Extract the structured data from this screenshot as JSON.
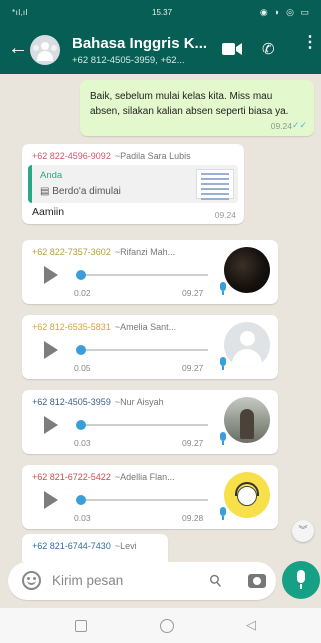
{
  "status_bar": {
    "signal": "*ıl‚ıl",
    "time": "15.37",
    "icons": "◉ ◗ ◎ ▭"
  },
  "header": {
    "title": "Bahasa Inggris K...",
    "subtitle": "+62 812-4505-3959, +62..."
  },
  "messages": {
    "outgoing": {
      "text": "Baik,  sebelum mulai kelas kita. Miss mau absen, silakan kalian absen seperti biasa ya.",
      "time": "09.24",
      "ticks": "✓✓"
    },
    "reply": {
      "phone": "+62 822-4596-9092",
      "alias": "~Padila Sara Lubis",
      "quote_author": "Anda",
      "quote_text": "Berdo'a dimulai",
      "text": "Aamiin",
      "time": "09.24"
    },
    "voice_notes": [
      {
        "phone": "+62 822-7357-3602",
        "alias": "~Rifanzi Mah...",
        "duration": "0.02",
        "time": "09.27"
      },
      {
        "phone": "+62 812-6535-5831",
        "alias": "~Amelia Sant...",
        "duration": "0.05",
        "time": "09.27"
      },
      {
        "phone": "+62 812-4505-3959",
        "alias": "~Nur Aisyah",
        "duration": "0.03",
        "time": "09.27"
      },
      {
        "phone": "+62 821-6722-5422",
        "alias": "~Adellia Flan...",
        "duration": "0.03",
        "time": "09.28"
      }
    ],
    "partial": {
      "phone": "+62 821-6744-7430",
      "alias": "~Levi"
    }
  },
  "composer": {
    "placeholder": "Kirim pesan"
  },
  "icons": {
    "back": "arrow-left-icon",
    "video": "video-camera-icon",
    "call": "phone-icon",
    "more": "more-vert-icon",
    "emoji": "emoji-icon",
    "attach": "paperclip-icon",
    "camera": "camera-icon",
    "mic": "mic-icon",
    "play": "play-icon",
    "scroll": "chevron-double-down-icon"
  },
  "colors": {
    "header": "#075e54",
    "accent": "#16a085",
    "outgoing_bubble": "#e3f8cc",
    "read_ticks": "#4fb6ec"
  }
}
